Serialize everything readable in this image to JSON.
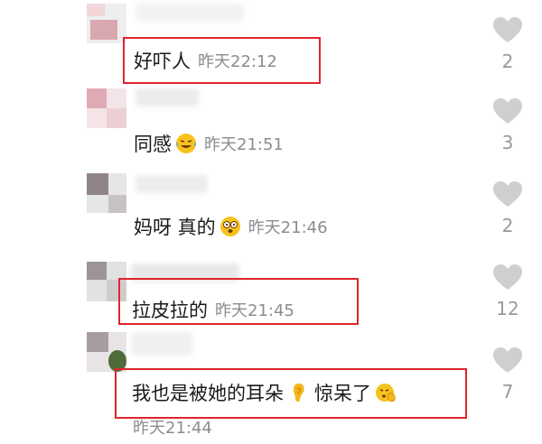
{
  "comments": [
    {
      "text": "好吓人",
      "time": "昨天22:12",
      "likes": "2"
    },
    {
      "text": "同感",
      "emoji": "laughing-crying-emoji",
      "time": "昨天21:51",
      "likes": "3"
    },
    {
      "text": "妈呀 真的",
      "emoji": "shocked-emoji",
      "time": "昨天21:46",
      "likes": "2"
    },
    {
      "text": "拉皮拉的",
      "time": "昨天21:45",
      "likes": "12"
    },
    {
      "text": "我也是被她的耳朵",
      "emoji": "ear-emoji",
      "text2": "惊呆了",
      "emoji2": "shh-emoji",
      "time": "昨天21:44",
      "likes": "7"
    }
  ],
  "colors": {
    "highlight_box": "#e0242b",
    "timestamp": "#8c8c8c",
    "like_icon": "#cfcfcf"
  }
}
